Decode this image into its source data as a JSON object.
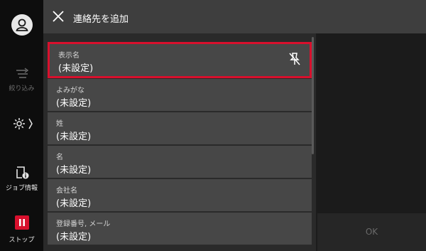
{
  "header": {
    "title": "連絡先を追加"
  },
  "sidebar": {
    "filter_label": "絞り込み",
    "job_info_label": "ジョブ情報",
    "stop_label": "ストップ"
  },
  "fields": [
    {
      "label": "表示名",
      "value": "(未設定)"
    },
    {
      "label": "よみがな",
      "value": "(未設定)"
    },
    {
      "label": "姓",
      "value": "(未設定)"
    },
    {
      "label": "名",
      "value": "(未設定)"
    },
    {
      "label": "会社名",
      "value": "(未設定)"
    },
    {
      "label": "登録番号, メール",
      "value": "(未設定)"
    }
  ],
  "footer": {
    "ok_label": "OK"
  },
  "colors": {
    "accent": "#d8102d",
    "panel": "#474747",
    "background": "#2a2a2a"
  }
}
